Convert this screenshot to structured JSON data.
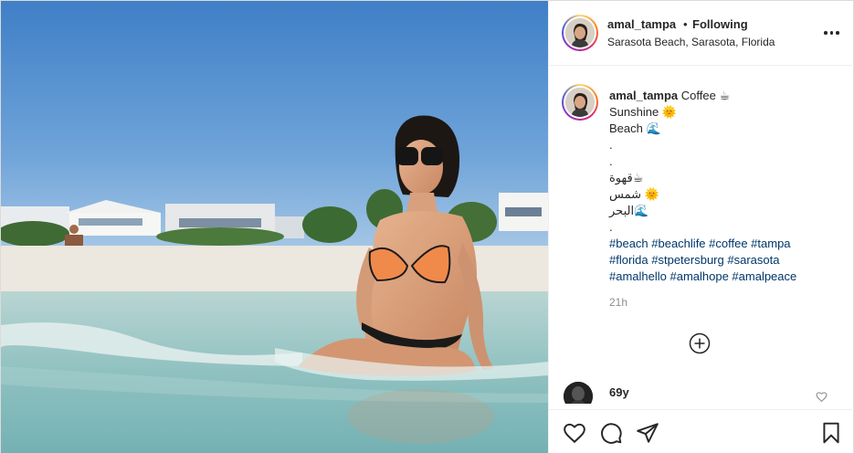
{
  "header": {
    "username": "amal_tampa",
    "separator": "•",
    "follow_status": "Following",
    "location": "Sarasota Beach, Sarasota, Florida"
  },
  "caption": {
    "username": "amal_tampa",
    "lines": [
      "Coffee ☕",
      "Sunshine 🌞",
      "Beach 🌊",
      ".",
      ".",
      "قهوة☕",
      "شمس 🌞",
      "البحر🌊",
      "."
    ],
    "hashtag_lines": [
      "#beach #beachlife #coffee #tampa",
      "#florida #stpetersburg #sarasota",
      "#amalhello #amalhope #amalpeace"
    ],
    "time": "21h"
  },
  "comment": {
    "username": "69y"
  },
  "icons": {
    "more": "more-horizontal-icon",
    "load_more": "plus-circle-icon",
    "like": "heart-icon",
    "comment": "comment-icon",
    "share": "paper-plane-icon",
    "save": "bookmark-icon",
    "comment_like": "heart-small-icon"
  },
  "colors": {
    "hashtag": "#00376b",
    "text": "#262626",
    "muted": "#8e8e8e",
    "divider": "#efefef"
  }
}
